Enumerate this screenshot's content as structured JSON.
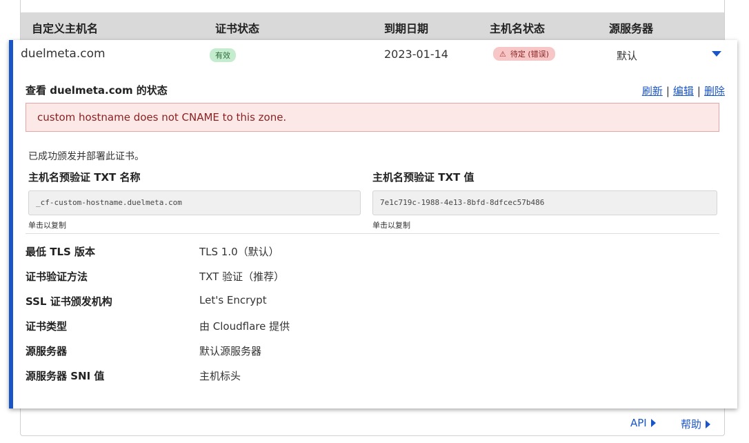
{
  "table": {
    "columns": [
      "自定义主机名",
      "证书状态",
      "到期日期",
      "主机名状态",
      "源服务器"
    ]
  },
  "row": {
    "hostname": "duelmeta.com",
    "cert_status": "有效",
    "expiry": "2023-01-14",
    "hostname_status": "待定 (错误)",
    "origin": "默认"
  },
  "detail": {
    "title": "查看 duelmeta.com 的状态",
    "actions": {
      "refresh": "刷新",
      "edit": "编辑",
      "delete": "删除"
    },
    "error": "custom hostname does not CNAME to this zone.",
    "deploy_message": "已成功颁发并部署此证书。",
    "txt_name": {
      "label": "主机名预验证 TXT 名称",
      "value": "_cf-custom-hostname.duelmeta.com",
      "hint": "单击以复制"
    },
    "txt_value": {
      "label": "主机名预验证 TXT 值",
      "value": "7e1c719c-1988-4e13-8bfd-8dfcec57b486",
      "hint": "单击以复制"
    },
    "properties": [
      {
        "label": "最低 TLS 版本",
        "value": "TLS 1.0（默认）"
      },
      {
        "label": "证书验证方法",
        "value": "TXT 验证（推荐）"
      },
      {
        "label": "SSL 证书颁发机构",
        "value": "Let's Encrypt"
      },
      {
        "label": "证书类型",
        "value": "由 Cloudflare 提供"
      },
      {
        "label": "源服务器",
        "value": "默认源服务器"
      },
      {
        "label": "源服务器 SNI 值",
        "value": "主机标头"
      }
    ]
  },
  "footer": {
    "api": "API",
    "help": "帮助"
  },
  "colors": {
    "accent": "#1a55c8",
    "valid_bg": "#c6ecd0",
    "error_bg": "#fde8e8",
    "pending_bg": "#f7c7c7"
  },
  "icons": {
    "pending": "warning-triangle-icon",
    "expand": "caret-down-icon",
    "link": "caret-right-icon"
  }
}
